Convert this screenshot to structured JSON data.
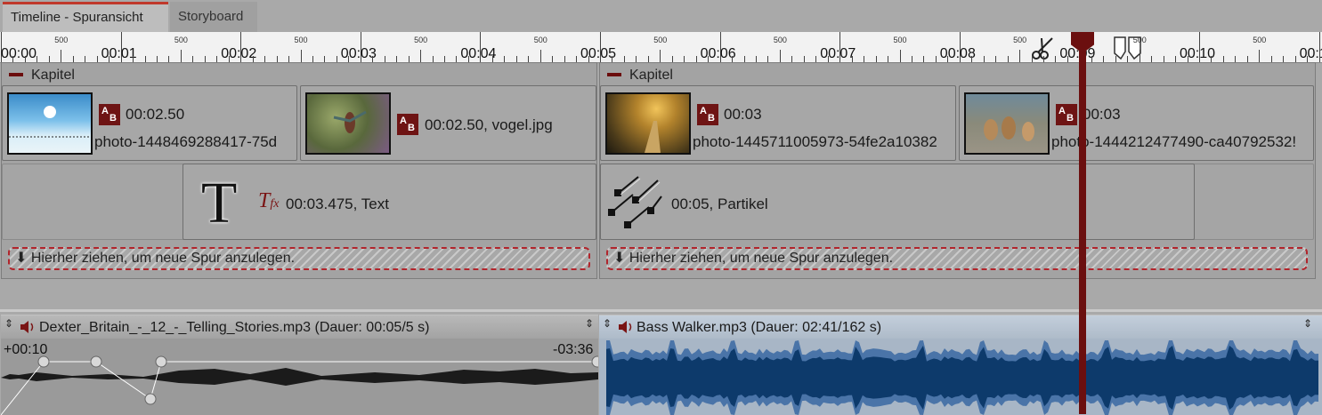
{
  "tabs": [
    {
      "label": "Timeline - Spuransicht",
      "active": true
    },
    {
      "label": "Storyboard",
      "active": false
    }
  ],
  "ruler": {
    "labels": [
      "00:00",
      "00:01",
      "00:02",
      "00:03",
      "00:04",
      "00:05",
      "00:06",
      "00:07",
      "00:08",
      "00:09",
      "00:10",
      "00:1"
    ],
    "half_labels": [
      "500",
      "500",
      "500",
      "500",
      "500",
      "500",
      "500",
      "500",
      "500",
      "500",
      "500"
    ]
  },
  "chapters": [
    {
      "title": "Kapitel"
    },
    {
      "title": "Kapitel"
    }
  ],
  "clips": [
    {
      "duration": "00:02.50",
      "filename": "photo-1448469288417-75d"
    },
    {
      "duration": "00:02.50, vogel.jpg",
      "filename": ""
    },
    {
      "duration": "00:03",
      "filename": "photo-1445711005973-54fe2a10382"
    },
    {
      "duration": "00:03",
      "filename": "photo-1444212477490-ca40792532!"
    }
  ],
  "ab_icon_text": {
    "a": "A",
    "b": "B"
  },
  "text_clip": {
    "label": "00:03.475, Text",
    "glyph": "T",
    "fx_icon": "T",
    "fx_sub": "fx"
  },
  "particle_clip": {
    "label": "00:05, Partikel"
  },
  "dropzones": [
    {
      "label": "Hierher ziehen, um neue Spur anzulegen.",
      "arrow": "⬇"
    },
    {
      "label": "Hierher ziehen, um neue Spur anzulegen.",
      "arrow": "⬇"
    }
  ],
  "audio": [
    {
      "title": "Dexter_Britain_-_12_-_Telling_Stories.mp3 (Dauer: 00:05/5 s)",
      "offset_start": "+00:10",
      "offset_end": "-03:36"
    },
    {
      "title": "Bass Walker.mp3 (Dauer: 02:41/162 s)"
    }
  ],
  "icons": {
    "speaker": "speaker-icon",
    "scissors": "scissors-icon",
    "marker": "marker-icon",
    "resize": "resize-handle-icon"
  },
  "colors": {
    "accent": "#c0392b",
    "playhead": "#6b0f0f",
    "waveform_blue": "#0d3a6b",
    "waveform_light": "#4a74a8",
    "ab_icon": "#6e1414"
  }
}
